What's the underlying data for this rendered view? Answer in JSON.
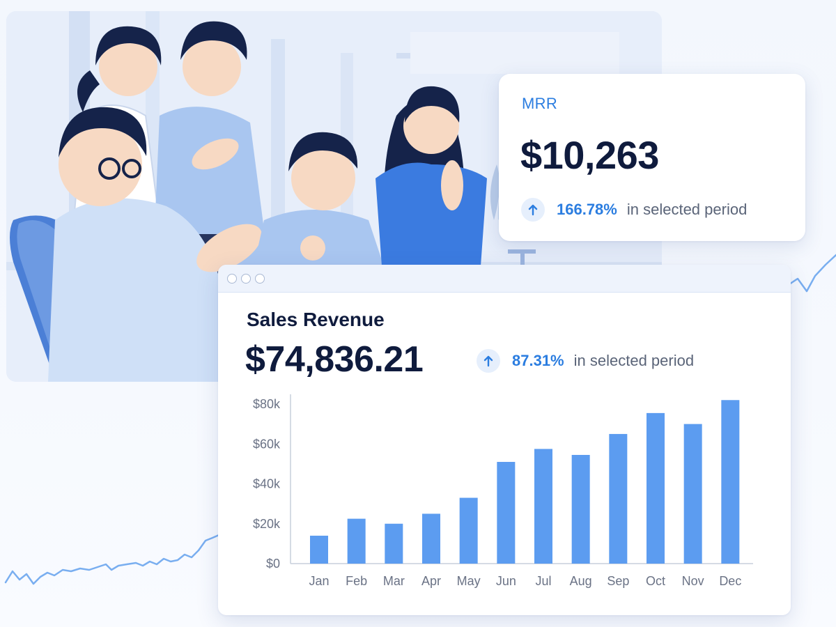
{
  "mrr": {
    "label": "MRR",
    "value": "$10,263",
    "change_pct": "166.78%",
    "change_text": "in selected period",
    "change_icon": "arrow-up-icon"
  },
  "sales": {
    "title": "Sales Revenue",
    "value": "$74,836.21",
    "change_pct": "87.31%",
    "change_text": "in selected period",
    "change_icon": "arrow-up-icon"
  },
  "colors": {
    "accent": "#2b7de0",
    "bar": "#5c9cf0",
    "text_dark": "#0f1b3d",
    "text_muted": "#5a6478"
  },
  "chart_data": {
    "type": "bar",
    "title": "Sales Revenue",
    "categories": [
      "Jan",
      "Feb",
      "Mar",
      "Apr",
      "May",
      "Jun",
      "Jul",
      "Aug",
      "Sep",
      "Oct",
      "Nov",
      "Dec"
    ],
    "values": [
      14000,
      22500,
      20000,
      25000,
      33000,
      51000,
      57500,
      54500,
      65000,
      75500,
      70000,
      82000
    ],
    "ylim": [
      0,
      80000
    ],
    "yticks": [
      0,
      20000,
      40000,
      60000,
      80000
    ],
    "ytick_labels": [
      "$0",
      "$20k",
      "$40k",
      "$60k",
      "$80k"
    ],
    "xlabel": "",
    "ylabel": "",
    "grid": false
  }
}
